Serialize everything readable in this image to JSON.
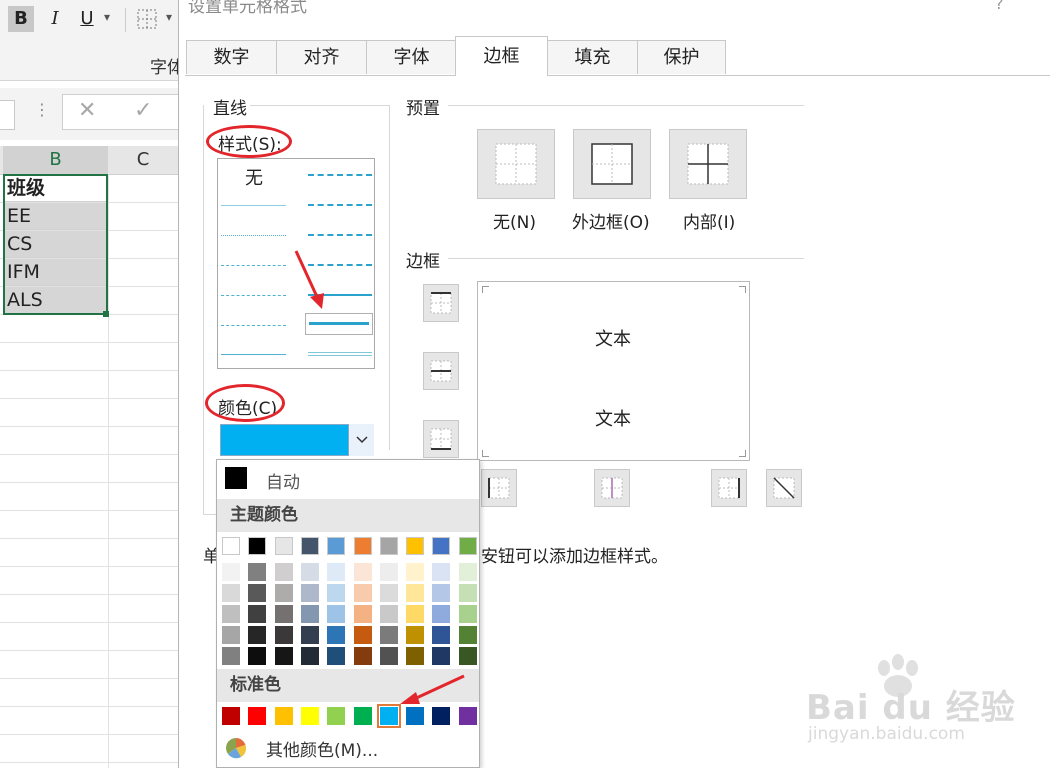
{
  "toolbar": {
    "bold": "B",
    "italic": "I",
    "underline": "U",
    "dropdown": "▾",
    "group_label": "字体"
  },
  "formula_bar": {
    "cancel": "✕",
    "confirm": "✓"
  },
  "sheet": {
    "columns": [
      "B",
      "C"
    ],
    "cells": [
      "班级",
      "EE",
      "CS",
      "IFM",
      "ALS"
    ]
  },
  "dialog": {
    "title": "设置单元格格式",
    "help": "?",
    "tabs": [
      "数字",
      "对齐",
      "字体",
      "边框",
      "填充",
      "保护"
    ],
    "active_tab": "边框",
    "line_section": "直线",
    "style_label": "样式(S):",
    "style_none": "无",
    "color_label": "颜色(C)",
    "selected_color": "#00b0f0",
    "preset_section": "预置",
    "presets": [
      "无(N)",
      "外边框(O)",
      "内部(I)"
    ],
    "border_section": "边框",
    "preview_text": [
      "文本",
      "文本"
    ],
    "hint_prefix": "单",
    "hint_suffix": "安钮可以添加边框样式。"
  },
  "color_popup": {
    "auto_label": "自动",
    "theme_label": "主题颜色",
    "standard_label": "标准色",
    "more_label": "其他颜色(M)...",
    "theme_colors": [
      "#ffffff",
      "#000000",
      "#e7e6e6",
      "#44546a",
      "#5b9bd5",
      "#ed7d31",
      "#a5a5a5",
      "#ffc000",
      "#4472c4",
      "#70ad47"
    ],
    "theme_shades": [
      [
        "#f2f2f2",
        "#d9d9d9",
        "#bfbfbf",
        "#a6a6a6",
        "#808080"
      ],
      [
        "#808080",
        "#595959",
        "#404040",
        "#262626",
        "#0d0d0d"
      ],
      [
        "#d0cece",
        "#aeabab",
        "#757171",
        "#3a3838",
        "#171616"
      ],
      [
        "#d6dce5",
        "#adb9ca",
        "#8497b0",
        "#333f50",
        "#222a35"
      ],
      [
        "#deebf7",
        "#bdd7ee",
        "#9dc3e6",
        "#2e75b6",
        "#1f4e79"
      ],
      [
        "#fbe5d6",
        "#f8cbad",
        "#f4b183",
        "#c55a11",
        "#843c0c"
      ],
      [
        "#ededed",
        "#dbdbdb",
        "#c9c9c9",
        "#7b7b7b",
        "#525252"
      ],
      [
        "#fff2cc",
        "#ffe699",
        "#ffd966",
        "#bf9000",
        "#7f6000"
      ],
      [
        "#dae3f3",
        "#b4c7e7",
        "#8faadc",
        "#2f5597",
        "#203864"
      ],
      [
        "#e2f0d9",
        "#c5e0b4",
        "#a9d18e",
        "#548235",
        "#385723"
      ]
    ],
    "standard_colors": [
      "#c00000",
      "#ff0000",
      "#ffc000",
      "#ffff00",
      "#92d050",
      "#00b050",
      "#00b0f0",
      "#0070c0",
      "#002060",
      "#7030a0"
    ],
    "selected_standard_index": 6
  },
  "watermark": {
    "brand": "Bai du 经验",
    "url": "jingyan.baidu.com"
  }
}
